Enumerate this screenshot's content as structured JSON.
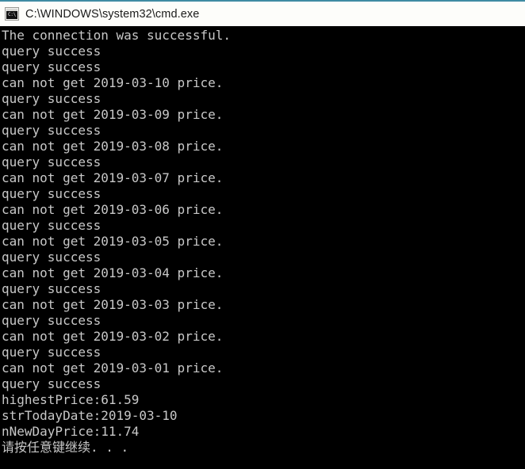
{
  "window": {
    "title": "C:\\WINDOWS\\system32\\cmd.exe",
    "icon_name": "cmd-console-icon",
    "icon_glyph": "C:\\",
    "accent_color": "#3f8ba3",
    "titlebar_bg": "#fdfdfa",
    "titlebar_text_color": "#1b1b1b",
    "console_bg": "#000000",
    "console_text_color": "#c8c8c8"
  },
  "console": {
    "lines": [
      "The connection was successful.",
      "query success",
      "query success",
      "can not get 2019-03-10 price.",
      "query success",
      "can not get 2019-03-09 price.",
      "query success",
      "can not get 2019-03-08 price.",
      "query success",
      "can not get 2019-03-07 price.",
      "query success",
      "can not get 2019-03-06 price.",
      "query success",
      "can not get 2019-03-05 price.",
      "query success",
      "can not get 2019-03-04 price.",
      "query success",
      "can not get 2019-03-03 price.",
      "query success",
      "can not get 2019-03-02 price.",
      "query success",
      "can not get 2019-03-01 price.",
      "query success",
      "highestPrice:61.59",
      "strTodayDate:2019-03-10",
      "nNewDayPrice:11.74",
      "请按任意键继续. . ."
    ]
  }
}
